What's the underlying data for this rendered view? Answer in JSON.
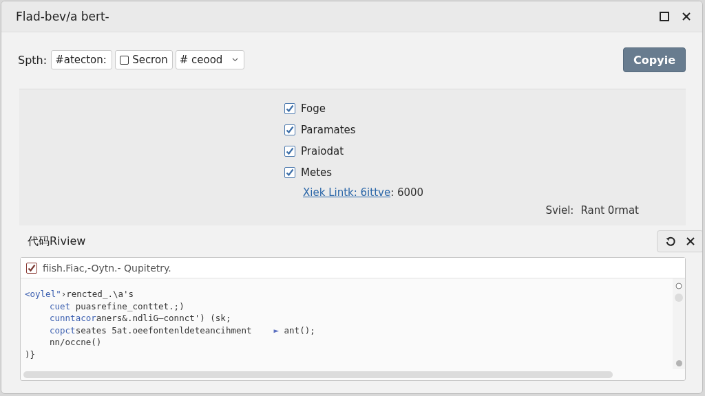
{
  "window": {
    "title": "Flad-bev/a bert-"
  },
  "toolbar": {
    "label": "Spth:",
    "field": {
      "value": "#atecton:"
    },
    "toggle": {
      "label": "Secron",
      "checked": false
    },
    "dropdown": {
      "value": "# ceood"
    },
    "copy_button": "Copyie"
  },
  "options": [
    {
      "label": "Foge",
      "checked": true
    },
    {
      "label": "Paramates",
      "checked": true
    },
    {
      "label": "Praiodat",
      "checked": true
    },
    {
      "label": "Metes",
      "checked": true
    }
  ],
  "link": {
    "text": "Xiek Lintk: 6ittve",
    "value": ": 6000"
  },
  "status": {
    "label": "Sviel:",
    "value": "Rant 0rmat"
  },
  "review": {
    "title": "代码Riview",
    "header": {
      "label": "fiish.Fiac,-Oytn.- Qupitetry.",
      "checked": true
    },
    "lines": [
      {
        "segments": [
          {
            "kind": "keyword",
            "text": "<oylel\""
          },
          {
            "kind": "plain",
            "text": "›rencted_.\\a's"
          }
        ],
        "children": [
          {
            "segments": [
              {
                "kind": "keyword",
                "text": "cuet"
              },
              {
                "kind": "plain",
                "text": " puasrefine_conttet.;)"
              }
            ]
          },
          {
            "segments": [
              {
                "kind": "keyword",
                "text": "cunntacor"
              },
              {
                "kind": "plain",
                "text": "aners&.ndliG—connct') (sk;"
              }
            ]
          },
          {
            "segments": [
              {
                "kind": "keyword",
                "text": "copct"
              },
              {
                "kind": "plain",
                "text": "seates 5at.oeefontenldeteancihment"
              },
              {
                "kind": "arrow",
                "text": "►"
              },
              {
                "kind": "plain",
                "text": " ant();"
              }
            ]
          },
          {
            "segments": [
              {
                "kind": "plain",
                "text": "nn/occne()"
              }
            ]
          }
        ]
      },
      {
        "segments": [
          {
            "kind": "plain",
            "text": ")}"
          }
        ]
      }
    ]
  }
}
